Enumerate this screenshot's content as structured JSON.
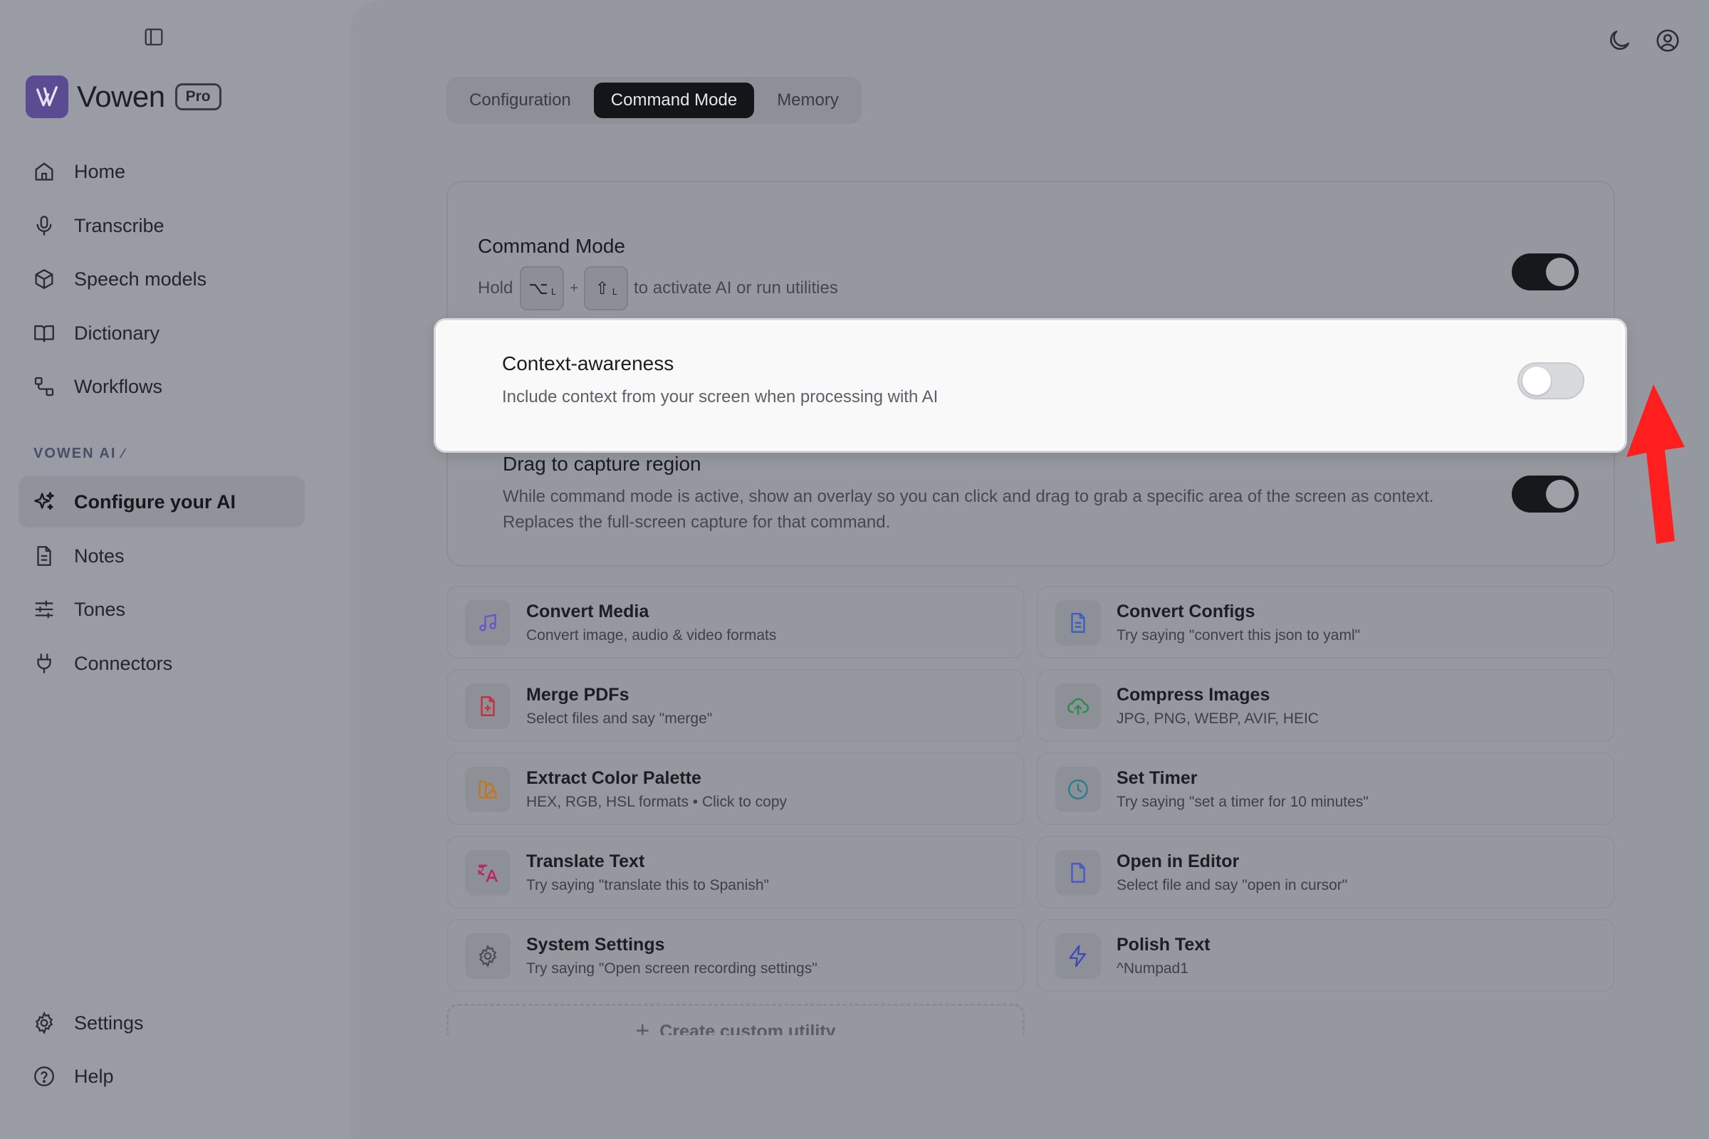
{
  "app": {
    "name": "Vowen",
    "badge": "Pro"
  },
  "sidebar": {
    "nav": [
      {
        "label": "Home",
        "icon": "home-icon"
      },
      {
        "label": "Transcribe",
        "icon": "microphone-icon"
      },
      {
        "label": "Speech models",
        "icon": "cube-icon"
      },
      {
        "label": "Dictionary",
        "icon": "book-open-icon"
      },
      {
        "label": "Workflows",
        "icon": "workflow-icon"
      }
    ],
    "section_label": "VOWEN AI",
    "ai_nav": [
      {
        "label": "Configure your AI",
        "icon": "sparkles-icon",
        "active": true
      },
      {
        "label": "Notes",
        "icon": "note-icon"
      },
      {
        "label": "Tones",
        "icon": "sliders-icon"
      },
      {
        "label": "Connectors",
        "icon": "plug-icon"
      }
    ],
    "bottom": [
      {
        "label": "Settings",
        "icon": "gear-icon"
      },
      {
        "label": "Help",
        "icon": "help-circle-icon"
      }
    ]
  },
  "tabs": [
    {
      "label": "Configuration",
      "active": false
    },
    {
      "label": "Command Mode",
      "active": true
    },
    {
      "label": "Memory",
      "active": false
    }
  ],
  "command_mode": {
    "title": "Command Mode",
    "hold_prefix": "Hold",
    "key1": "⌥",
    "key1_side": "L",
    "plus": "+",
    "key2": "⇧",
    "key2_side": "L",
    "hold_suffix": "to activate AI or run utilities",
    "enabled": true
  },
  "context_awareness": {
    "title": "Context-awareness",
    "description": "Include context from your screen when processing with AI",
    "enabled": false
  },
  "drag_capture": {
    "title": "Drag to capture region",
    "description_line1": "While command mode is active, show an overlay so you can click and drag to grab a specific area of the screen as context.",
    "description_line2": "Replaces the full-screen capture for that command.",
    "enabled": true
  },
  "utilities": [
    {
      "title": "Convert Media",
      "subtitle": "Convert image, audio & video formats",
      "icon": "music-note-icon",
      "color": "#6a55c8"
    },
    {
      "title": "Convert Configs",
      "subtitle": "Try saying \"convert this json to yaml\"",
      "icon": "document-icon",
      "color": "#3c5fc4"
    },
    {
      "title": "Merge PDFs",
      "subtitle": "Select files and say \"merge\"",
      "icon": "file-plus-icon",
      "color": "#c6303a"
    },
    {
      "title": "Compress Images",
      "subtitle": "JPG, PNG, WEBP, AVIF, HEIC",
      "icon": "cloud-upload-icon",
      "color": "#2f8a50"
    },
    {
      "title": "Extract Color Palette",
      "subtitle": "HEX, RGB, HSL formats • Click to copy",
      "icon": "palette-icon",
      "color": "#c2771c"
    },
    {
      "title": "Set Timer",
      "subtitle": "Try saying \"set a timer for 10 minutes\"",
      "icon": "clock-icon",
      "color": "#2a7f8c"
    },
    {
      "title": "Translate Text",
      "subtitle": "Try saying \"translate this to Spanish\"",
      "icon": "translate-icon",
      "color": "#b8266a"
    },
    {
      "title": "Open in Editor",
      "subtitle": "Select file and say \"open in cursor\"",
      "icon": "file-icon",
      "color": "#4858c8"
    },
    {
      "title": "System Settings",
      "subtitle": "Try saying \"Open screen recording settings\"",
      "icon": "gear-icon",
      "color": "#4a4c55"
    },
    {
      "title": "Polish Text",
      "subtitle": "^Numpad1",
      "icon": "lightning-icon",
      "color": "#3d4bb8"
    }
  ],
  "create_utility": {
    "label": "Create custom utility"
  },
  "colors": {
    "annotation_arrow": "#ff1f1f",
    "brand": "#5b4b93"
  }
}
